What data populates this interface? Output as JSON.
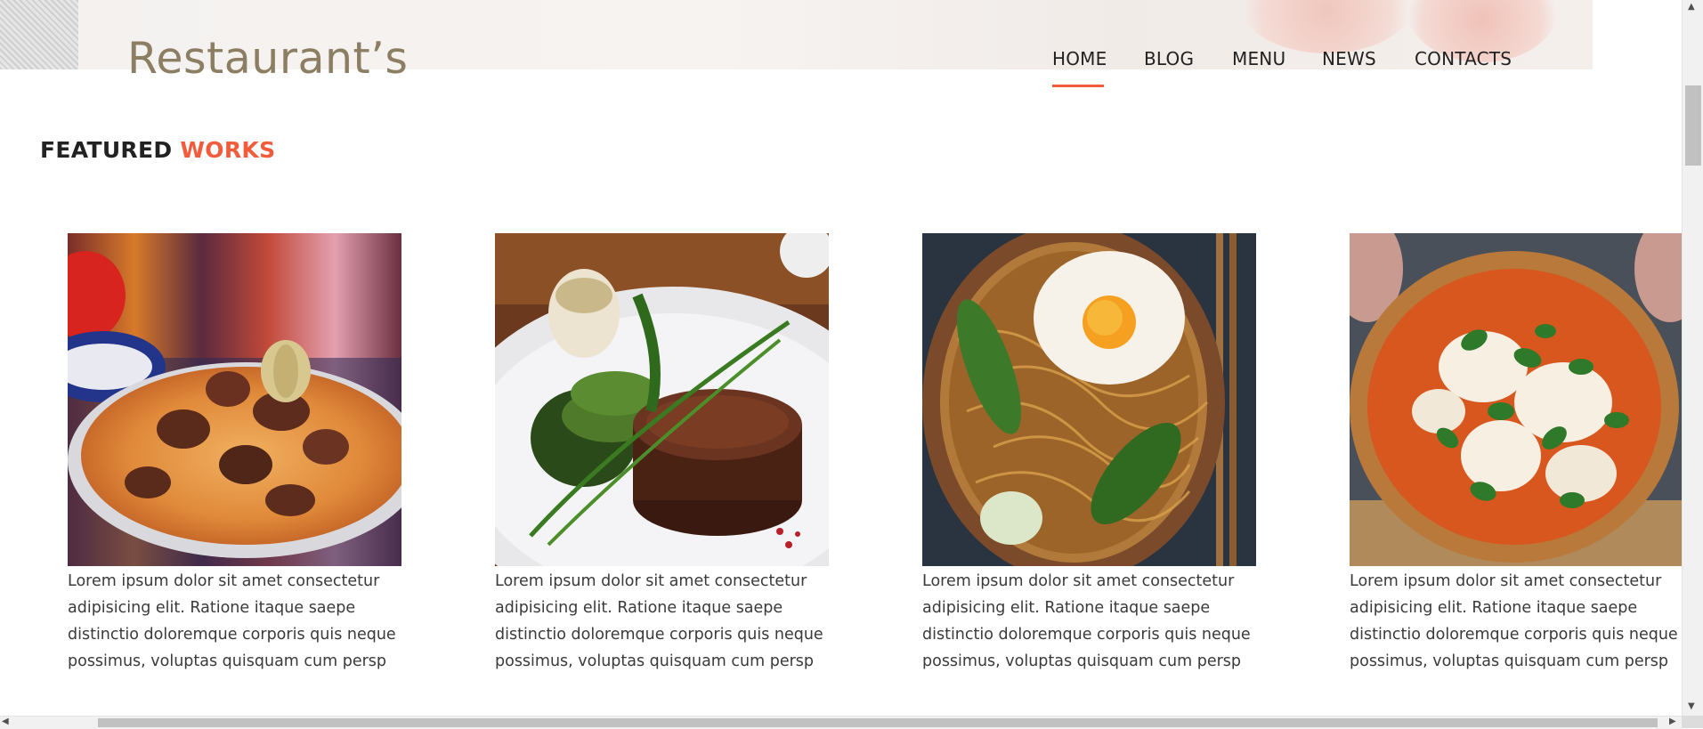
{
  "header": {
    "logo": "Restaurant’s",
    "nav": [
      "HOME",
      "BLOG",
      "MENU",
      "NEWS",
      "CONTACTS"
    ],
    "active_nav": "HOME",
    "accent_color": "#f25c3b"
  },
  "section": {
    "title_part1": "FEATURED",
    "title_part2": "WORKS"
  },
  "cards": [
    {
      "image": "plov-photo",
      "caption": "Lorem ipsum dolor sit amet consectetur adipisicing elit. Ratione itaque saepe distinctio doloremque corporis quis neque possimus, voluptas quisquam cum persp"
    },
    {
      "image": "steak-photo",
      "caption": "Lorem ipsum dolor sit amet consectetur adipisicing elit. Ratione itaque saepe distinctio doloremque corporis quis neque possimus, voluptas quisquam cum persp"
    },
    {
      "image": "noodles-photo",
      "caption": "Lorem ipsum dolor sit amet consectetur adipisicing elit. Ratione itaque saepe distinctio doloremque corporis quis neque possimus, voluptas quisquam cum persp"
    },
    {
      "image": "pizza-photo",
      "caption": "Lorem ipsum dolor sit amet consectetur adipisicing elit. Ratione itaque saepe distinctio doloremque corporis quis neque possimus, voluptas quisquam cum persp"
    }
  ]
}
